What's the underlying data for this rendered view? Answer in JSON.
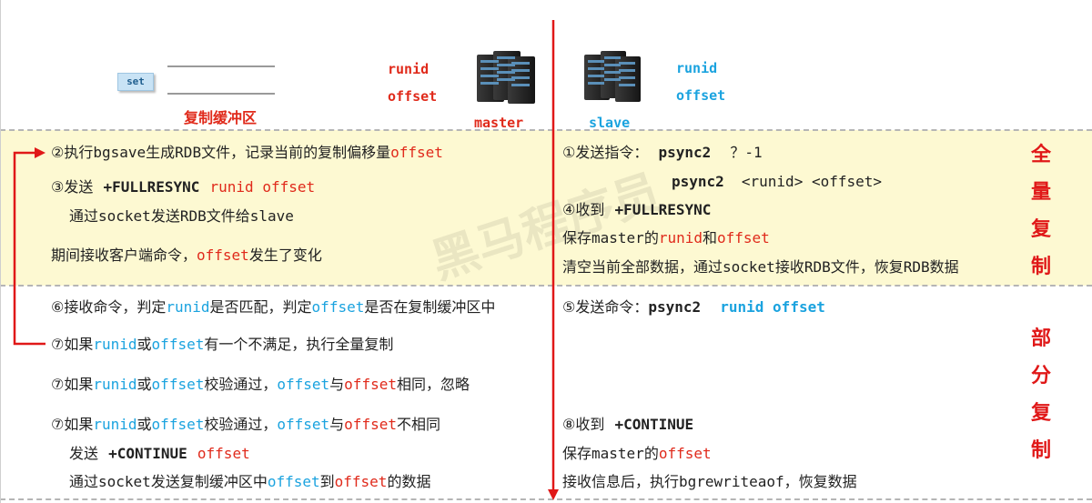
{
  "top": {
    "set_button": "set",
    "buffer_label": "复制缓冲区",
    "master_runid": "runid",
    "master_offset": "offset",
    "master_label": "master",
    "slave_label": "slave",
    "slave_runid": "runid",
    "slave_offset": "offset"
  },
  "full": {
    "left": {
      "l1_a": "②执行",
      "l1_b": "bgsave",
      "l1_c": "生成",
      "l1_d": "RDB",
      "l1_e": "文件，记录当前的复制偏移量",
      "l1_f": "offset",
      "l2_a": "③发送",
      "l2_b": "+FULLRESYNC",
      "l2_c": "runid offset",
      "l3_a": "通过",
      "l3_b": "socket",
      "l3_c": "发送",
      "l3_d": "RDB",
      "l3_e": "文件给",
      "l3_f": "slave",
      "l4_a": "期间接收客户端命令，",
      "l4_b": "offset",
      "l4_c": "发生了变化"
    },
    "right": {
      "r1_a": "①发送指令：",
      "r1_b": "psync2",
      "r1_c": "？-1",
      "r2_b": "psync2",
      "r2_c": "<runid> <offset>",
      "r3_a": "④收到",
      "r3_b": "+FULLRESYNC",
      "r4_a": "保存",
      "r4_b": "master",
      "r4_c": "的",
      "r4_d": "runid",
      "r4_e": "和",
      "r4_f": "offset",
      "r5_a": "清空当前全部数据，通过",
      "r5_b": "socket",
      "r5_c": "接收",
      "r5_d": "RDB",
      "r5_e": "文件，恢复",
      "r5_f": "RDB",
      "r5_g": "数据"
    },
    "side_label": [
      "全",
      "量",
      "复",
      "制"
    ]
  },
  "partial": {
    "left": {
      "p1_a": "⑥接收命令，判定",
      "p1_b": "runid",
      "p1_c": "是否匹配，判定",
      "p1_d": "offset",
      "p1_e": "是否在复制缓冲区中",
      "p2_a": "⑦如果",
      "p2_b": "runid",
      "p2_c": "或",
      "p2_d": "offset",
      "p2_e": "有一个不满足，执行全量复制",
      "p3_a": "⑦如果",
      "p3_b": "runid",
      "p3_c": "或",
      "p3_d": "offset",
      "p3_e": "校验通过，",
      "p3_f": "offset",
      "p3_g": "与",
      "p3_h": "offset",
      "p3_i": "相同，忽略",
      "p4_a": "⑦如果",
      "p4_b": "runid",
      "p4_c": "或",
      "p4_d": "offset",
      "p4_e": "校验通过，",
      "p4_f": "offset",
      "p4_g": "与",
      "p4_h": "offset",
      "p4_i": "不相同",
      "p5_a": "发送",
      "p5_b": "+CONTINUE",
      "p5_c": "offset",
      "p6_a": "通过",
      "p6_b": "socket",
      "p6_c": "发送复制缓冲区中",
      "p6_d": "offset",
      "p6_e": "到",
      "p6_f": "offset",
      "p6_g": "的数据"
    },
    "right": {
      "q1_a": "⑤发送命令：",
      "q1_b": "psync2",
      "q1_c": "runid offset",
      "q2_a": "⑧收到",
      "q2_b": "+CONTINUE",
      "q3_a": "保存",
      "q3_b": "master",
      "q3_c": "的",
      "q3_d": "offset",
      "q4_a": "接收信息后，执行",
      "q4_b": "bgrewriteaof",
      "q4_c": "，恢复数据"
    },
    "side_label": [
      "部",
      "分",
      "复",
      "制"
    ]
  },
  "colors": {
    "red": "#e02a1b",
    "blue": "#1ba3df",
    "band": "#fdf9d2",
    "side": "#e01818"
  }
}
